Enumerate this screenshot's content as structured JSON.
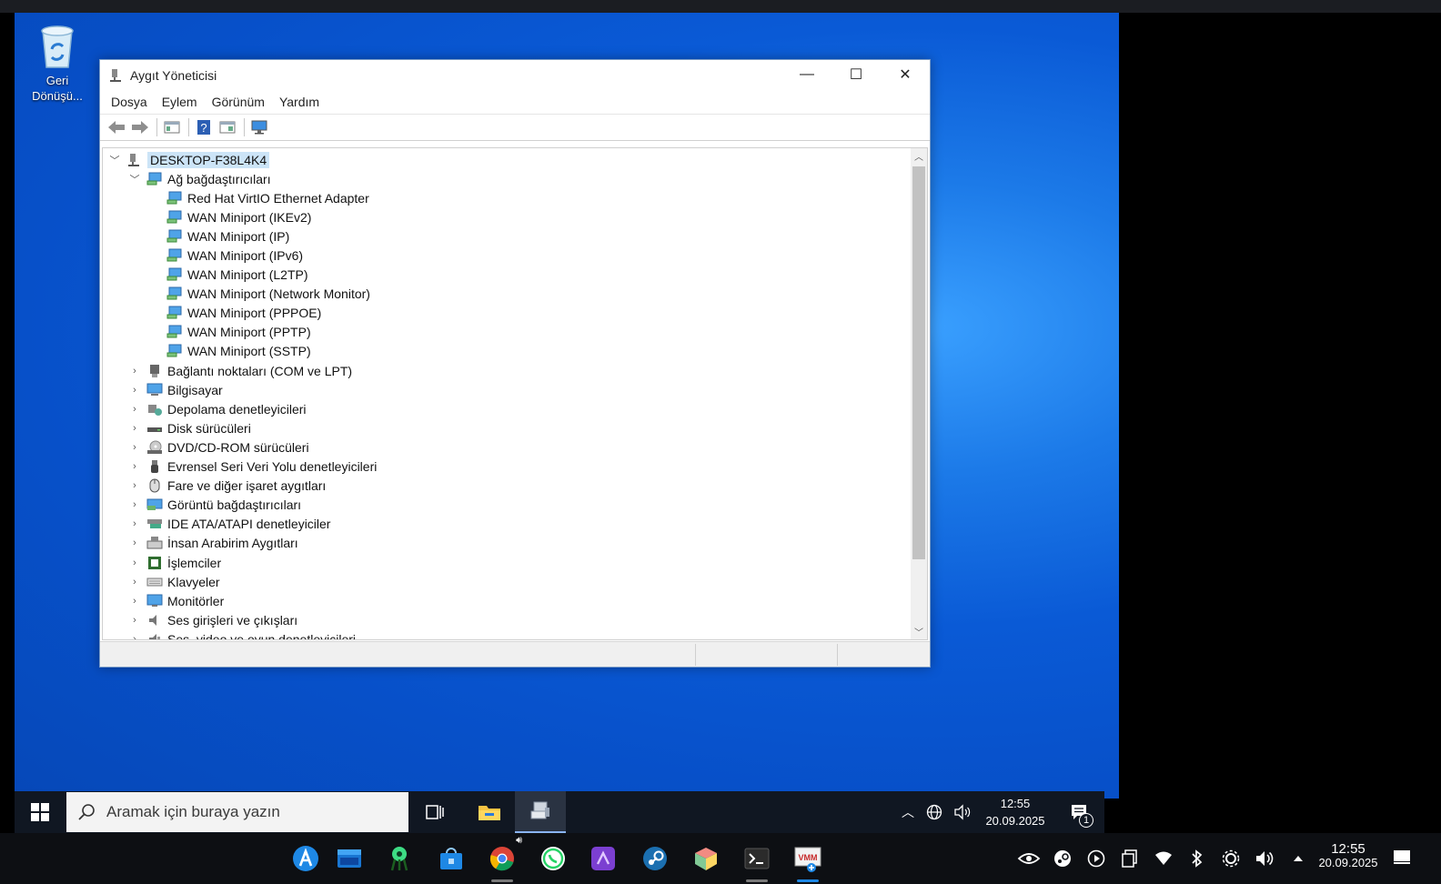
{
  "desktop": {
    "recycle_bin_label": "Geri Dönüşü..."
  },
  "window": {
    "title": "Aygıt Yöneticisi",
    "controls": {
      "minimize": "—",
      "maximize": "☐",
      "close": "✕"
    },
    "menu": [
      "Dosya",
      "Eylem",
      "Görünüm",
      "Yardım"
    ],
    "tree": {
      "root": "DESKTOP-F38L4K4",
      "expanded_category": "Ağ bağdaştırıcıları",
      "network_devices": [
        "Red Hat VirtIO Ethernet Adapter",
        "WAN Miniport (IKEv2)",
        "WAN Miniport (IP)",
        "WAN Miniport (IPv6)",
        "WAN Miniport (L2TP)",
        "WAN Miniport (Network Monitor)",
        "WAN Miniport (PPPOE)",
        "WAN Miniport (PPTP)",
        "WAN Miniport (SSTP)"
      ],
      "categories": [
        "Bağlantı noktaları (COM ve LPT)",
        "Bilgisayar",
        "Depolama denetleyicileri",
        "Disk sürücüleri",
        "DVD/CD-ROM sürücüleri",
        "Evrensel Seri Veri Yolu denetleyicileri",
        "Fare ve diğer işaret aygıtları",
        "Görüntü bağdaştırıcıları",
        "IDE ATA/ATAPI denetleyiciler",
        "İnsan Arabirim Aygıtları",
        "İşlemciler",
        "Klavyeler",
        "Monitörler",
        "Ses girişleri ve çıkışları",
        "Ses, video ve oyun denetleyicileri"
      ]
    }
  },
  "vm_taskbar": {
    "search_placeholder": "Aramak için buraya yazın",
    "clock_time": "12:55",
    "clock_date": "20.09.2025",
    "notification_count": "1"
  },
  "host_taskbar": {
    "clock_time": "12:55",
    "clock_date": "20.09.2025"
  }
}
